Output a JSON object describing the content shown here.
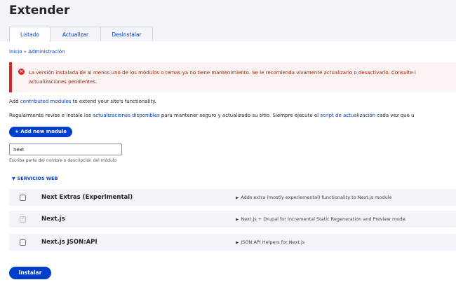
{
  "page": {
    "title": "Extender"
  },
  "tabs": [
    {
      "label": "Listado",
      "active": true
    },
    {
      "label": "Actualizar",
      "active": false
    },
    {
      "label": "Desinstalar",
      "active": false
    }
  ],
  "breadcrumb": {
    "home": "Inicio",
    "separator": "»",
    "current": "Administración"
  },
  "alert": {
    "icon": "error-icon",
    "line1": "La versión instalada de al menos uno de los módulos o temas ya no tiene mantenimiento. Se le recomienda vivamente actualizarlo o desactivarlo. Consulte l",
    "line2": "actualizaciones pendientes.",
    "color": "#d72222"
  },
  "intro": {
    "line1_prefix": "Add",
    "line1_link": "contributed modules",
    "line1_suffix": "to extend your site's functionality.",
    "line2_prefix": "Regularmente revise e instale las",
    "line2_link1": "actualizaciones disponibles",
    "line2_middle": "para mantener seguro y actualizado su sitio. Siempre ejecute el",
    "line2_link2": "script de actualización",
    "line2_suffix": "cada vez que u"
  },
  "add_module_button": "+ Add new module",
  "filter": {
    "value": "next",
    "help": "Escriba parte del nombre o descripción del módulo"
  },
  "group": {
    "caret": "▼",
    "label": "SERVICIOS WEB"
  },
  "modules": [
    {
      "name": "Next Extras (Experimental)",
      "description": "Adds extra (mostly experiemental) functionality to Next.js module",
      "checked": false,
      "disabled": false
    },
    {
      "name": "Next.js",
      "description": "Next.js + Drupal for Incremental Static Regeneration and Preview mode.",
      "checked": true,
      "disabled": true
    },
    {
      "name": "Next.js JSON:API",
      "description": "JSON:API Helpers for Next.js",
      "checked": false,
      "disabled": false
    }
  ],
  "install_button": "Instalar",
  "colors": {
    "accent": "#003ecc",
    "header_bg": "#f3f4f9",
    "error": "#d72222"
  }
}
